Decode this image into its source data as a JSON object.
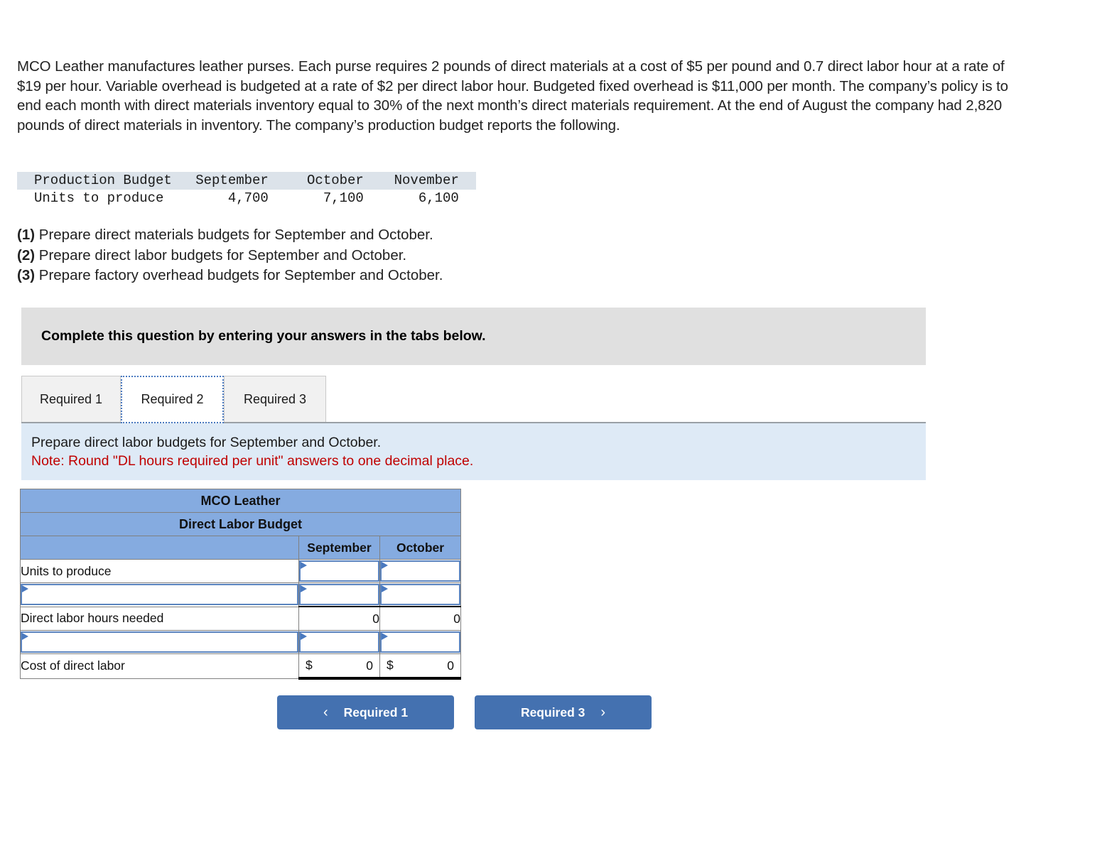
{
  "problem": {
    "text": "MCO Leather manufactures leather purses. Each purse requires 2 pounds of direct materials at a cost of $5 per pound and 0.7 direct labor hour at a rate of $19 per hour. Variable overhead is budgeted at a rate of $2 per direct labor hour. Budgeted fixed overhead is $11,000 per month. The company’s policy is to end each month with direct materials inventory equal to 30% of the next month’s direct materials requirement. At the end of August the company had 2,820 pounds of direct materials in inventory. The company’s production budget reports the following."
  },
  "production_budget": {
    "header": {
      "label": "Production Budget",
      "months": [
        "September",
        "October",
        "November"
      ]
    },
    "row": {
      "label": "Units to produce",
      "values": [
        "4,700",
        "7,100",
        "6,100"
      ]
    }
  },
  "requirements": [
    {
      "number": "(1)",
      "text": "Prepare direct materials budgets for September and October."
    },
    {
      "number": "(2)",
      "text": "Prepare direct labor budgets for September and October."
    },
    {
      "number": "(3)",
      "text": "Prepare factory overhead budgets for September and October."
    }
  ],
  "banner": {
    "text": "Complete this question by entering your answers in the tabs below."
  },
  "tabs": [
    {
      "label": "Required 1",
      "active": false
    },
    {
      "label": "Required 2",
      "active": true
    },
    {
      "label": "Required 3",
      "active": false
    }
  ],
  "note": {
    "instruction": "Prepare direct labor budgets for September and October.",
    "rounding": "Note: Round \"DL hours required per unit\" answers to one decimal place.",
    "note_color": "#c00000"
  },
  "dl_table": {
    "title": "MCO Leather",
    "subtitle": "Direct Labor Budget",
    "blank_column_header": "",
    "columns": [
      "September",
      "October"
    ],
    "rows": [
      {
        "label": "Units to produce",
        "type": "input",
        "september": "",
        "october": ""
      },
      {
        "label": "",
        "type": "input",
        "september": "",
        "october": "",
        "label_input": true
      },
      {
        "label": "Direct labor hours needed",
        "type": "computed",
        "september": "0",
        "october": "0"
      },
      {
        "label": "",
        "type": "input",
        "september": "",
        "october": "",
        "label_input": true
      },
      {
        "label": "Cost of direct labor",
        "type": "total",
        "september": "0",
        "october": "0",
        "currency": "$"
      }
    ],
    "header_color": "#85abe0",
    "input_border_color": "#5b84bf"
  },
  "nav": {
    "prev_label": "Required 1",
    "next_label": "Required 3",
    "prev_icon": "chevron-left-icon",
    "next_icon": "chevron-right-icon",
    "prev_chevron": "‹",
    "next_chevron": "›",
    "button_color": "#4471b0"
  }
}
